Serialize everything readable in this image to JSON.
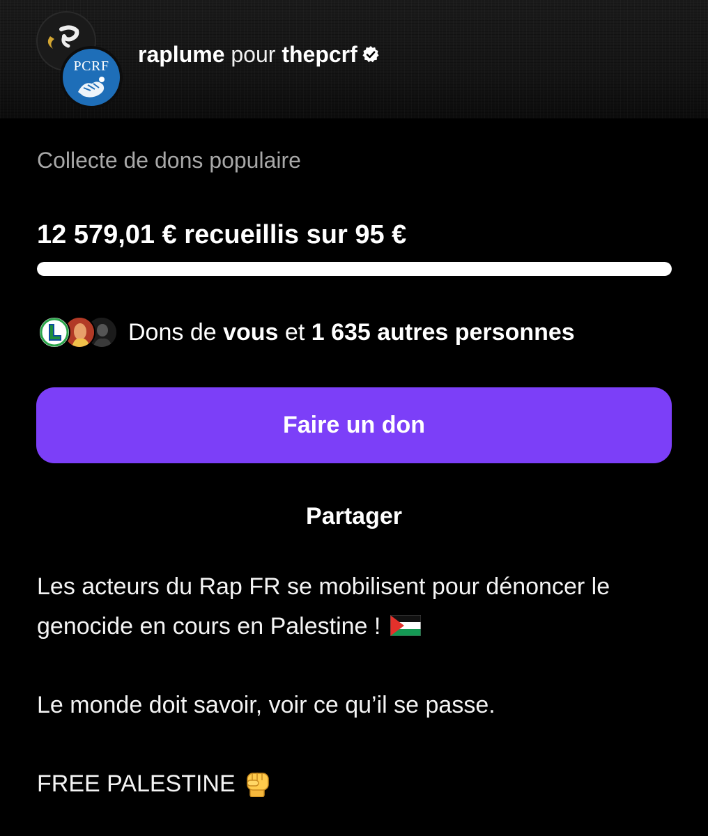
{
  "header": {
    "user": "raplume",
    "connector": "pour",
    "organization": "thepcrf",
    "verified": true,
    "avatar_logo_text": "PCRF"
  },
  "fundraiser": {
    "subtitle": "Collecte de dons populaire",
    "amount_text": "12 579,01 € recueillis sur 95 €",
    "progress_percent": 100,
    "donors": {
      "prefix": "Dons de",
      "you": "vous",
      "middle": "et",
      "count_text": "1 635 autres personnes"
    }
  },
  "actions": {
    "donate_label": "Faire un don",
    "share_label": "Partager"
  },
  "description": {
    "line1": "Les acteurs du Rap FR se mobilisent pour dénoncer le",
    "line2": "genocide en cours en Palestine !",
    "paragraph2": "Le monde doit savoir, voir ce qu’il se passe.",
    "paragraph3": "FREE PALESTINE"
  },
  "colors": {
    "background": "#000000",
    "accent_button": "#7c3ff8",
    "subtitle_gray": "#a8a8a8",
    "progress_fill": "#ffffff"
  },
  "icons": [
    "verified-badge-icon",
    "palestine-flag-icon",
    "raised-fist-icon"
  ]
}
